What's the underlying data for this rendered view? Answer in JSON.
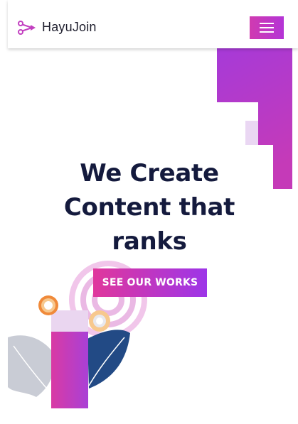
{
  "navbar": {
    "brand": "HayuJoin",
    "logo_icon": "scissors-arrow-logo-icon",
    "menu_icon": "hamburger-menu-icon"
  },
  "hero": {
    "title_lines": [
      "We Create",
      "Content that",
      "ranks"
    ],
    "cta_label": "SEE OUR WORKS"
  },
  "colors": {
    "accent_pink": "#e0379c",
    "accent_purple": "#9d35e8",
    "heading": "#141a3d"
  }
}
